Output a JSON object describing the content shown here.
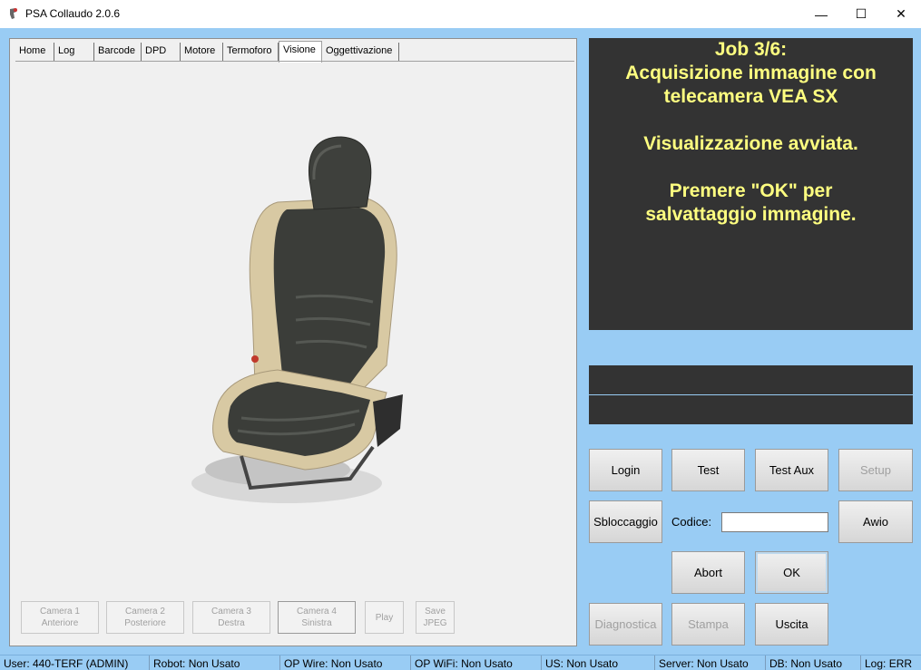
{
  "window": {
    "title": "PSA Collaudo 2.0.6",
    "minimize": "—",
    "maximize": "☐",
    "close": "✕"
  },
  "tabs": [
    "Home",
    "Log",
    "Barcode",
    "DPD",
    "Motore",
    "Termoforo",
    "Visione",
    "Oggettivazione"
  ],
  "active_tab": "Visione",
  "camera_buttons": {
    "cam1": {
      "line1": "Camera 1",
      "line2": "Anteriore"
    },
    "cam2": {
      "line1": "Camera 2",
      "line2": "Posteriore"
    },
    "cam3": {
      "line1": "Camera 3",
      "line2": "Destra"
    },
    "cam4": {
      "line1": "Camera 4",
      "line2": "Sinistra"
    },
    "play": "Play",
    "save": {
      "line1": "Save",
      "line2": "JPEG"
    }
  },
  "message": {
    "line1": "Job 3/6:",
    "line2": "Acquisizione immagine con",
    "line3": "telecamera VEA SX",
    "line4": "Visualizzazione avviata.",
    "line5": "Premere \"OK\" per",
    "line6": "salvattaggio immagine."
  },
  "buttons": {
    "login": "Login",
    "test": "Test",
    "test_aux": "Test Aux",
    "setup": "Setup",
    "sbloccaggio": "Sbloccaggio",
    "avvio": "Awio",
    "abort": "Abort",
    "ok": "OK",
    "diagnostica": "Diagnostica",
    "stampa": "Stampa",
    "uscita": "Uscita"
  },
  "codice": {
    "label": "Codice:",
    "value": ""
  },
  "status_bar": {
    "user": "User: 440-TERF (ADMIN)",
    "robot": "Robot: Non Usato",
    "op_wire": "OP Wire: Non Usato",
    "op_wifi": "OP WiFi: Non Usato",
    "us": "US: Non Usato",
    "server": "Server: Non Usato",
    "db": "DB: Non Usato",
    "log": "Log: ERR"
  },
  "colors": {
    "message_bg": "#333333",
    "message_text": "#ffff80",
    "window_bg": "#99ccf4"
  }
}
